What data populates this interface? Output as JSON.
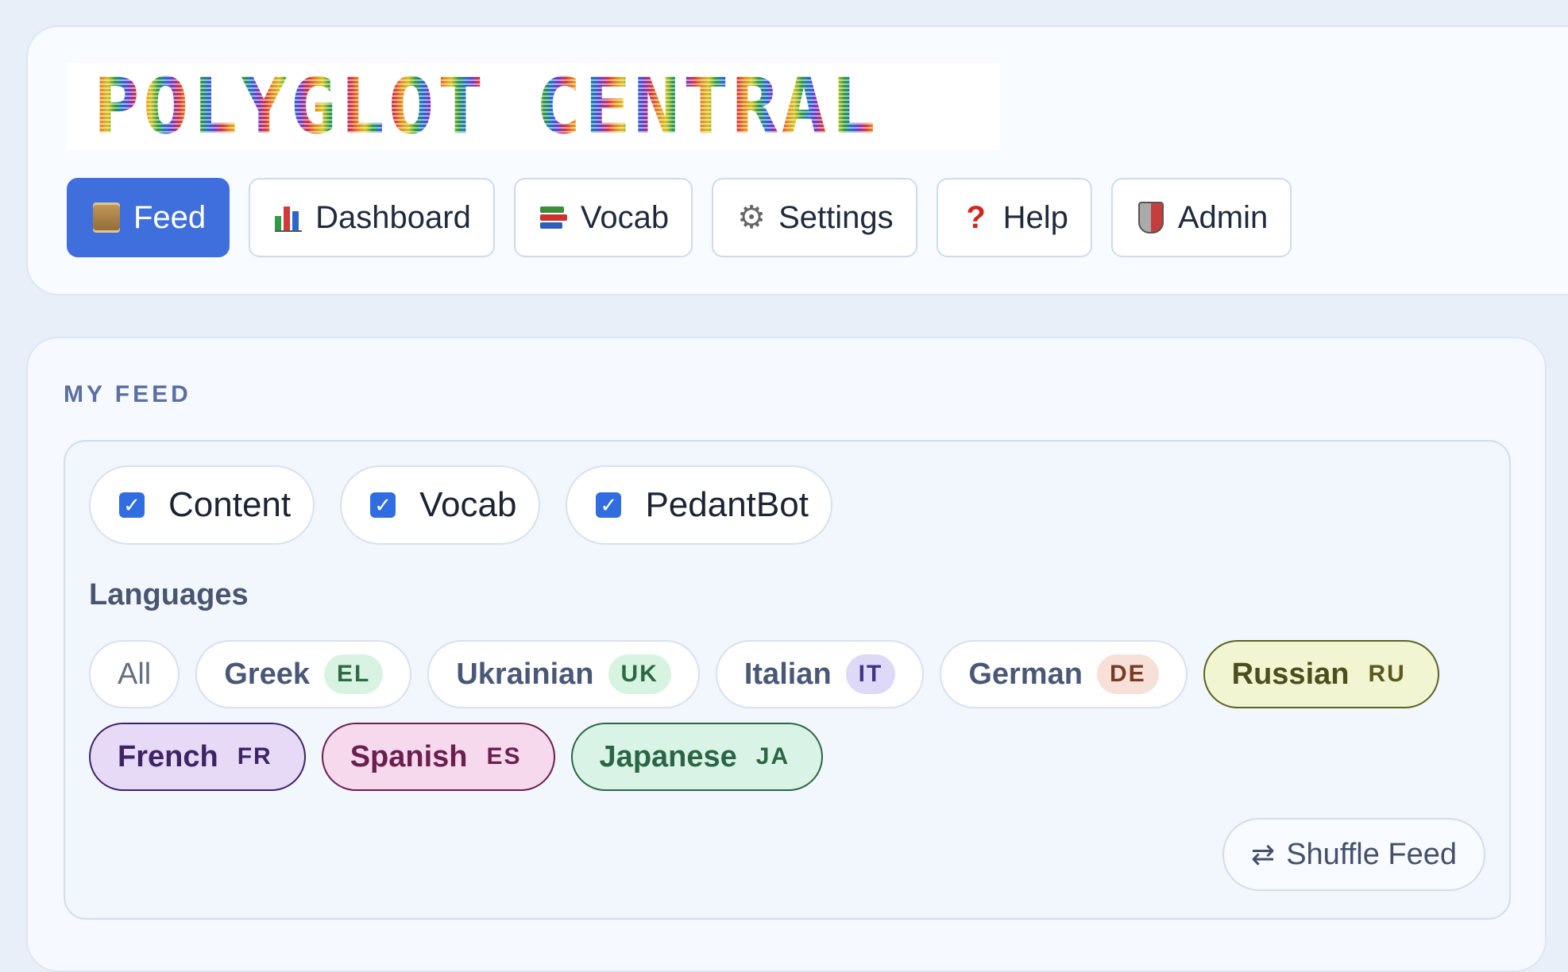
{
  "header": {
    "logo_text": "POLYGLOT CENTRAL"
  },
  "nav": {
    "items": [
      {
        "label": "Feed",
        "icon": "scroll-icon",
        "active": true
      },
      {
        "label": "Dashboard",
        "icon": "bar-chart-icon",
        "active": false
      },
      {
        "label": "Vocab",
        "icon": "books-icon",
        "active": false
      },
      {
        "label": "Settings",
        "icon": "gear-icon",
        "active": false
      },
      {
        "label": "Help",
        "icon": "question-icon",
        "active": false
      },
      {
        "label": "Admin",
        "icon": "shield-icon",
        "active": false
      }
    ],
    "active_color": "#3f6fdd"
  },
  "feed": {
    "title": "MY FEED",
    "filters": [
      {
        "label": "Content",
        "checked": true
      },
      {
        "label": "Vocab",
        "checked": true
      },
      {
        "label": "PedantBot",
        "checked": true
      }
    ],
    "checkbox_mark": "✓",
    "languages_label": "Languages",
    "all_label": "All",
    "languages": [
      {
        "name": "Greek",
        "code": "EL",
        "selected": false,
        "code_bg": "#d9f3e3",
        "code_color": "#2d6b46",
        "chip_bg": "#ffffff",
        "chip_border": "#d8e1ee",
        "name_color": "#4a5878"
      },
      {
        "name": "Ukrainian",
        "code": "UK",
        "selected": false,
        "code_bg": "#d7f3e1",
        "code_color": "#2a6a42",
        "chip_bg": "#ffffff",
        "chip_border": "#d8e1ee",
        "name_color": "#4a5878"
      },
      {
        "name": "Italian",
        "code": "IT",
        "selected": false,
        "code_bg": "#ddd9f6",
        "code_color": "#3f3785",
        "chip_bg": "#ffffff",
        "chip_border": "#d8e1ee",
        "name_color": "#4a5878"
      },
      {
        "name": "German",
        "code": "DE",
        "selected": false,
        "code_bg": "#f6e0d7",
        "code_color": "#7a3b25",
        "chip_bg": "#ffffff",
        "chip_border": "#d8e1ee",
        "name_color": "#4a5878"
      },
      {
        "name": "Russian",
        "code": "RU",
        "selected": true,
        "code_bg": "#f2f5d2",
        "code_color": "#5a5a1f",
        "chip_bg": "#f2f5d2",
        "chip_border": "#5d6324",
        "name_color": "#4a4f1c"
      },
      {
        "name": "French",
        "code": "FR",
        "selected": true,
        "code_bg": "#e7daf6",
        "code_color": "#3d2466",
        "chip_bg": "#e7daf6",
        "chip_border": "#3d2466",
        "name_color": "#3d2466"
      },
      {
        "name": "Spanish",
        "code": "ES",
        "selected": true,
        "code_bg": "#f6d9ec",
        "code_color": "#6a1f4e",
        "chip_bg": "#f6d9ec",
        "chip_border": "#6a1f4e",
        "name_color": "#6a1f4e"
      },
      {
        "name": "Japanese",
        "code": "JA",
        "selected": true,
        "code_bg": "#d9f4e6",
        "code_color": "#2a6644",
        "chip_bg": "#d9f4e6",
        "chip_border": "#2a6644",
        "name_color": "#2a6644"
      }
    ],
    "shuffle": {
      "label": "Shuffle Feed",
      "icon": "⇄"
    }
  }
}
